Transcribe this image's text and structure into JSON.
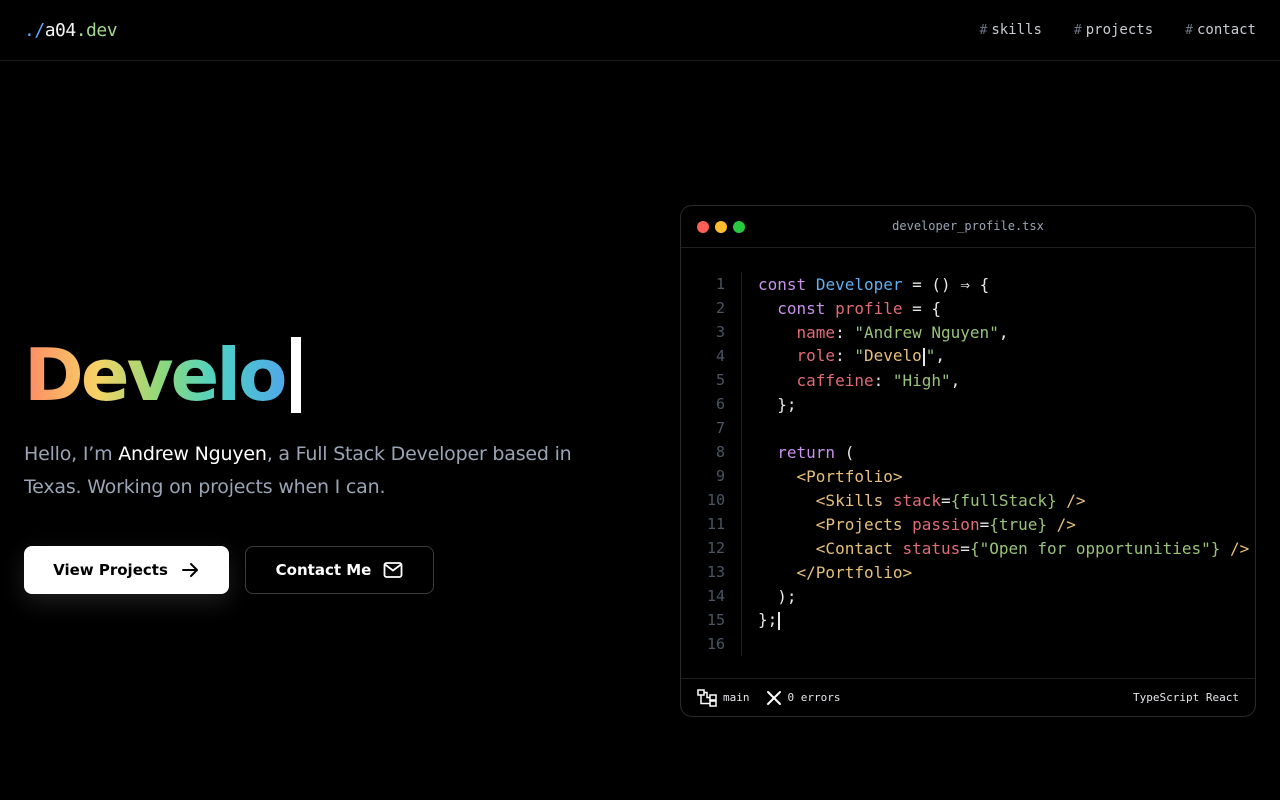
{
  "nav": {
    "logo": {
      "prefix": "./",
      "name": "a04",
      "tld": ".dev"
    },
    "links": [
      {
        "hash": "#",
        "label": "skills"
      },
      {
        "hash": "#",
        "label": "projects"
      },
      {
        "hash": "#",
        "label": "contact"
      }
    ]
  },
  "hero": {
    "typed_text": "Develo",
    "intro_before": "Hello, I’m ",
    "intro_name": "Andrew Nguyen",
    "intro_after": ", a Full Stack Developer based in Texas. Working on projects when I can.",
    "buttons": {
      "primary": "View Projects",
      "secondary": "Contact Me"
    }
  },
  "editor": {
    "filename": "developer_profile.tsx",
    "traffic_colors": [
      "#ff5f57",
      "#febc2e",
      "#28c840"
    ],
    "line_numbers": [
      "1",
      "2",
      "3",
      "4",
      "5",
      "6",
      "7",
      "8",
      "9",
      "10",
      "11",
      "12",
      "13",
      "14",
      "15",
      "16"
    ],
    "code": {
      "l1": {
        "kw": "const",
        "fn": "Developer",
        "rest": " = () ⇒ {"
      },
      "l2": {
        "kw": "const",
        "var": "profile",
        "rest": " = {"
      },
      "l3": {
        "key": "name",
        "val": "\"Andrew Nguyen\""
      },
      "l4": {
        "key": "role",
        "val_open": "\"",
        "val_typed": "Develo",
        "val_close": "\""
      },
      "l5": {
        "key": "caffeine",
        "val": "\"High\""
      },
      "l6": "};",
      "l8": {
        "kw": "return",
        "rest": " ("
      },
      "l9": "<Portfolio>",
      "l10": {
        "tag": "<Skills",
        "attr": "stack",
        "val": "{fullStack}",
        "end": " />"
      },
      "l11": {
        "tag": "<Projects",
        "attr": "passion",
        "val": "{true}",
        "end": " />"
      },
      "l12": {
        "tag": "<Contact",
        "attr": "status",
        "val": "{\"Open for opportunities\"}",
        "end": " />"
      },
      "l13": "</Portfolio>",
      "l14": ");",
      "l15": "};"
    },
    "status": {
      "branch": "main",
      "errors": "0 errors",
      "language": "TypeScript React"
    }
  }
}
